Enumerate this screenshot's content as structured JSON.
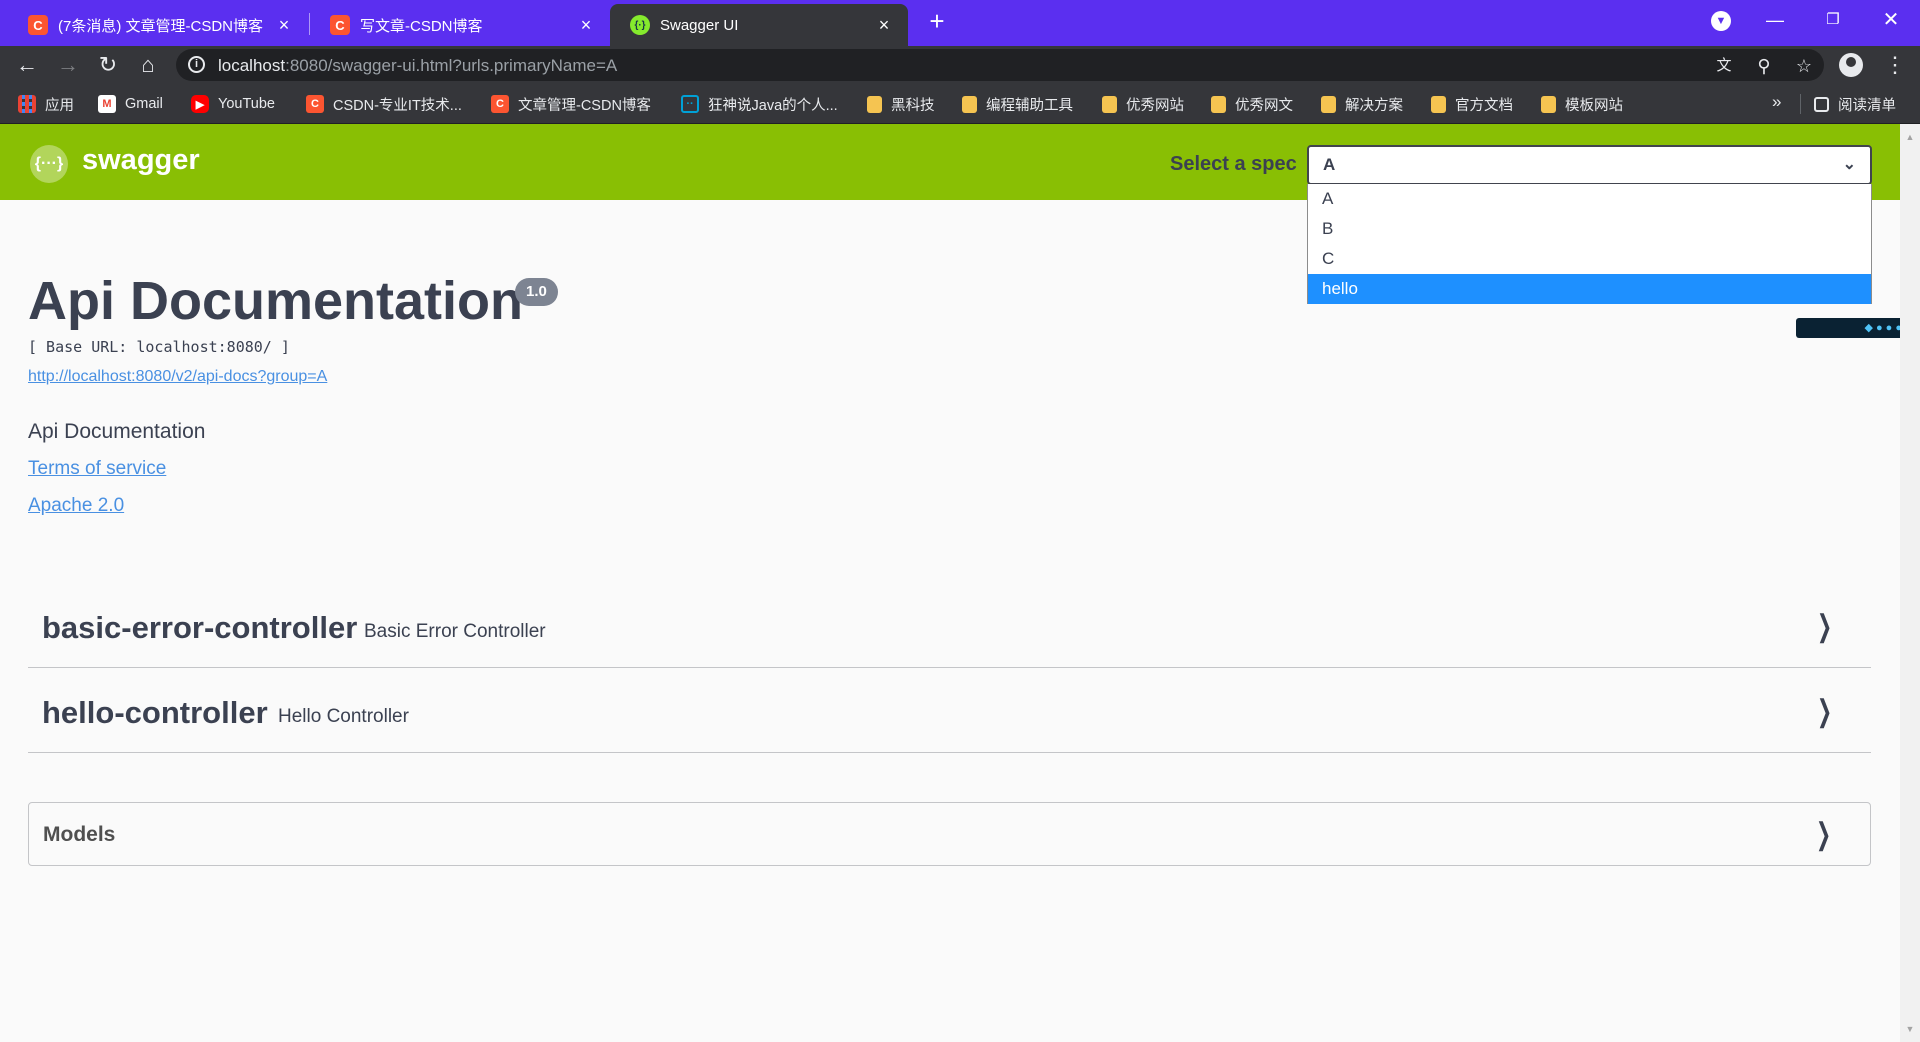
{
  "browser": {
    "tabs": [
      {
        "title": "(7条消息) 文章管理-CSDN博客",
        "favicon": "C"
      },
      {
        "title": "写文章-CSDN博客",
        "favicon": "C"
      },
      {
        "title": "Swagger UI",
        "favicon": "{·}"
      }
    ],
    "new_tab": "+",
    "url_host": "localhost",
    "url_rest": ":8080/swagger-ui.html?urls.primaryName=A",
    "bookmarks": [
      {
        "label": "应用",
        "icon": "apps-icon"
      },
      {
        "label": "Gmail",
        "icon": "gmail-icon"
      },
      {
        "label": "YouTube",
        "icon": "youtube-icon"
      },
      {
        "label": "CSDN-专业IT技术...",
        "icon": "csdn-icon"
      },
      {
        "label": "文章管理-CSDN博客",
        "icon": "csdn-icon"
      },
      {
        "label": "狂神说Java的个人...",
        "icon": "bilibili-icon"
      },
      {
        "label": "黑科技",
        "icon": "folder-icon"
      },
      {
        "label": "编程辅助工具",
        "icon": "folder-icon"
      },
      {
        "label": "优秀网站",
        "icon": "folder-icon"
      },
      {
        "label": "优秀网文",
        "icon": "folder-icon"
      },
      {
        "label": "解决方案",
        "icon": "folder-icon"
      },
      {
        "label": "官方文档",
        "icon": "folder-icon"
      },
      {
        "label": "模板网站",
        "icon": "folder-icon"
      }
    ],
    "more": "»",
    "reading_list": "阅读清单"
  },
  "swagger": {
    "logo_text": "swagger",
    "logo_glyph": "{···}",
    "select_label": "Select a spec",
    "selected_spec": "A",
    "spec_options": [
      "A",
      "B",
      "C",
      "hello"
    ],
    "highlighted_option": "hello"
  },
  "info": {
    "title": "Api Documentation",
    "version": "1.0",
    "base_url": "[ Base URL: localhost:8080/ ]",
    "api_docs_link": "http://localhost:8080/v2/api-docs?group=A",
    "description": "Api Documentation",
    "terms": "Terms of service",
    "license": "Apache 2.0"
  },
  "controllers": [
    {
      "name": "basic-error-controller",
      "description": "Basic Error Controller"
    },
    {
      "name": "hello-controller",
      "description": "Hello Controller"
    }
  ],
  "models_label": "Models",
  "colors": {
    "tabstrip": "#5b2ff0",
    "toolbar": "#35363a",
    "swagger_green": "#89bf04",
    "highlight": "#1e90ff",
    "link": "#4990e2"
  }
}
